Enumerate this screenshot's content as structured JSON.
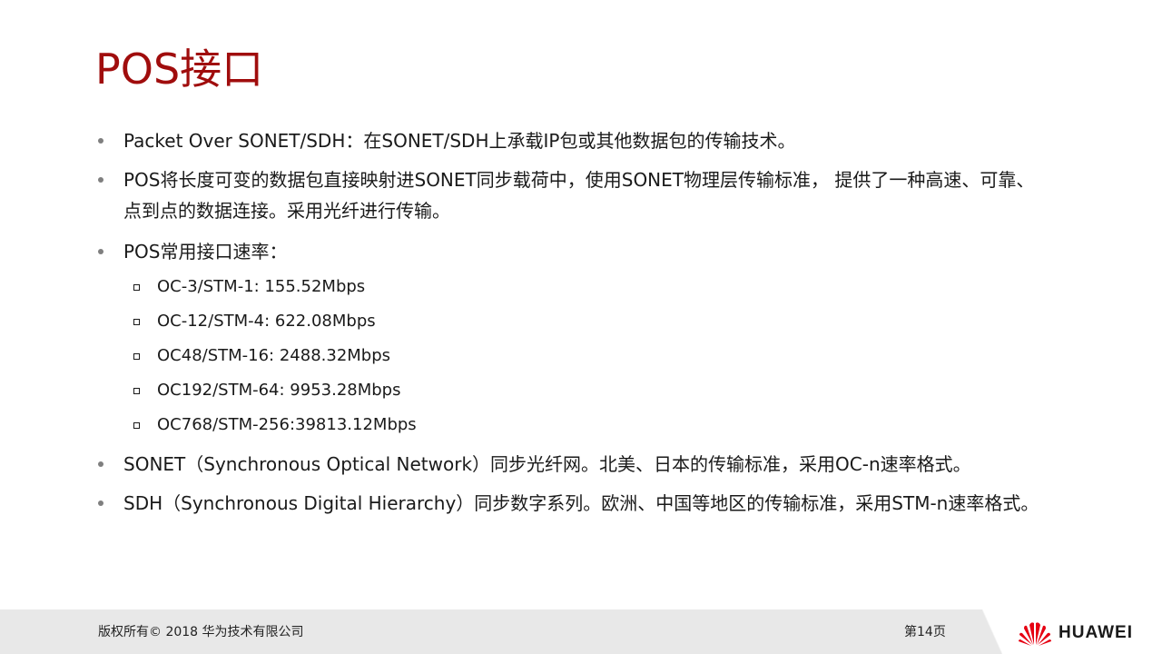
{
  "title": "POS接口",
  "bullets": [
    {
      "lines": [
        "Packet Over SONET/SDH：在SONET/SDH上承载IP包或其他数据包的传输技术。"
      ]
    },
    {
      "lines": [
        "POS将长度可变的数据包直接映射进SONET同步载荷中，使用SONET物理层传输标准，  提供了一种高速、可靠、",
        "点到点的数据连接。采用光纤进行传输。"
      ]
    },
    {
      "lines": [
        "POS常用接口速率："
      ]
    },
    {
      "lines": [
        "SONET（Synchronous Optical Network）同步光纤网。北美、日本的传输标准，采用OC-n速率格式。"
      ]
    },
    {
      "lines": [
        "SDH（Synchronous Digital Hierarchy）同步数字系列。欧洲、中国等地区的传输标准，采用STM-n速率格式。"
      ]
    }
  ],
  "rates": [
    "OC-3/STM-1: 155.52Mbps",
    "OC-12/STM-4: 622.08Mbps",
    "OC48/STM-16: 2488.32Mbps",
    "OC192/STM-64: 9953.28Mbps",
    "OC768/STM-256:39813.12Mbps"
  ],
  "footer": {
    "copyright": "版权所有© 2018 华为技术有限公司",
    "page": "第14页",
    "logo_text": "HUAWEI"
  },
  "colors": {
    "title": "#a00d0d",
    "logo": "#e60012",
    "footer_bg": "#e8e8e8"
  },
  "icons": {
    "bullet": "round-bullet-icon",
    "sub_bullet": "square-bullet-icon",
    "logo": "huawei-flower-logo-icon"
  }
}
